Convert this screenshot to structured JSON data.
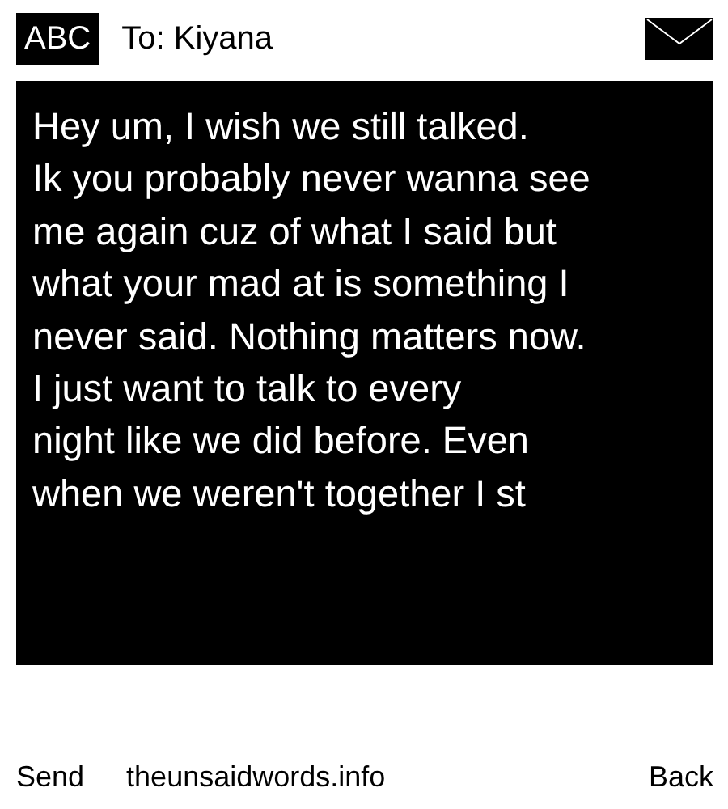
{
  "header": {
    "input_mode": "ABC",
    "recipient": "To: Kiyana"
  },
  "message": {
    "lines": [
      "Hey um, I wish we still talked.",
      "Ik you probably never wanna see",
      "me again cuz of what I said but",
      "what your mad at is something I",
      "never said. Nothing matters now.",
      "I just want to talk to every",
      "night like we did before. Even",
      "when we weren't together I st"
    ]
  },
  "footer": {
    "left": "Send",
    "site": "theunsaidwords.info",
    "right": "Back"
  }
}
